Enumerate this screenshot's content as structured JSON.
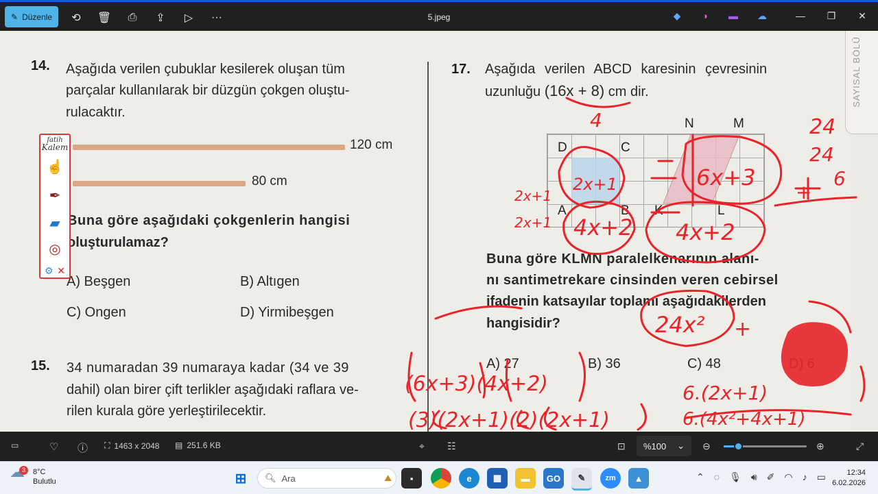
{
  "titlebar": {
    "edit_label": "Düzenle",
    "filename": "5.jpeg"
  },
  "side_label": "SAYISAL BÖLÜ",
  "fatih_tools": {
    "logo_top": "fatih",
    "logo_bottom": "Kalem"
  },
  "q14": {
    "number": "14.",
    "line1": "Aşağıda verilen çubuklar kesilerek oluşan tüm",
    "line2": "parçalar kullanılarak bir düzgün çokgen oluştu-",
    "line3": "rulacaktır.",
    "stick1_label": "120 cm",
    "stick2_label": "80 cm",
    "prompt1": "Buna göre aşağıdaki çokgenlerin hangisi",
    "prompt2": "oluşturulamaz?",
    "options": [
      "A) Beşgen",
      "B) Altıgen",
      "C) Ongen",
      "D) Yirmibeşgen"
    ]
  },
  "q15": {
    "number": "15.",
    "line1": "34 numaradan 39 numaraya kadar (34 ve 39",
    "line2": "dahil) olan birer çift terlikler aşağıdaki raflara ve-",
    "line3": "rilen kurala göre yerleştirilecektir."
  },
  "q17": {
    "number": "17.",
    "line1": "Aşağıda verilen ABCD karesinin çevresinin",
    "line2a": "uzunluğu",
    "line2b": "(16x + 8)",
    "line2c": "cm dir.",
    "grid_labels": [
      "D",
      "C",
      "N",
      "M",
      "A",
      "B",
      "K",
      "L"
    ],
    "prompt1": "Buna göre KLMN paralelkenarının alanı-",
    "prompt2": "nı santimetrekare cinsinden veren cebirsel",
    "prompt3": "ifadenin katsayılar toplamı aşağıdakilerden",
    "prompt4": "hangisidir?",
    "options": [
      "A) 27",
      "B) 36",
      "C) 48",
      "D) 6"
    ]
  },
  "ink_annotations": {
    "color": "#e8242a",
    "texts": [
      "4",
      "24",
      "24",
      "6",
      "+",
      "2x+1",
      "2x+1",
      "2x+1",
      "4x+2",
      "4x+2",
      "6x+3",
      "24x²",
      "(6x+3)(4x+2)",
      "(3)(2x+1)(2)(2x+1)",
      "6.(2x+1)",
      "6.(4x²+4x+1)"
    ]
  },
  "statusbar": {
    "dimensions": "1463 x 2048",
    "filesize": "251.6 KB",
    "zoom": "%100",
    "zoom_fraction": 0.17
  },
  "taskbar": {
    "weather_temp": "8°C",
    "weather_desc": "Bulutlu",
    "weather_badge": "3",
    "search_placeholder": "Ara",
    "time": "12:34",
    "date": "6.02.2026"
  }
}
